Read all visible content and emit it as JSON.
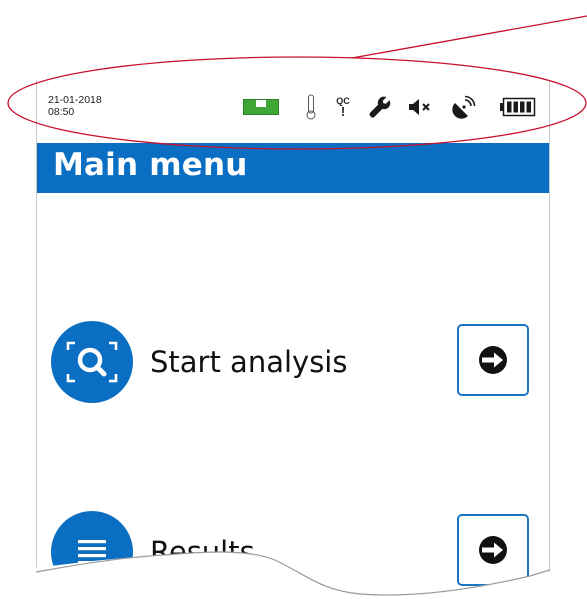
{
  "status_bar": {
    "date": "21-01-2018",
    "time": "08:50",
    "qc_label": "QC",
    "qc_mark": "!",
    "icons": [
      "level-icon",
      "thermometer-icon",
      "qc-warning-icon",
      "wrench-icon",
      "mute-icon",
      "satellite-icon",
      "battery-icon"
    ]
  },
  "header": {
    "title": "Main menu"
  },
  "menu": {
    "items": [
      {
        "label": "Start analysis",
        "icon": "search-icon",
        "action_icon": "arrow-right-icon"
      },
      {
        "label": "Results",
        "icon": "list-icon",
        "action_icon": "arrow-right-icon"
      }
    ]
  },
  "colors": {
    "brand_blue": "#0a6fc2",
    "level_green": "#3fa535",
    "annotation_red": "#c8102e"
  }
}
